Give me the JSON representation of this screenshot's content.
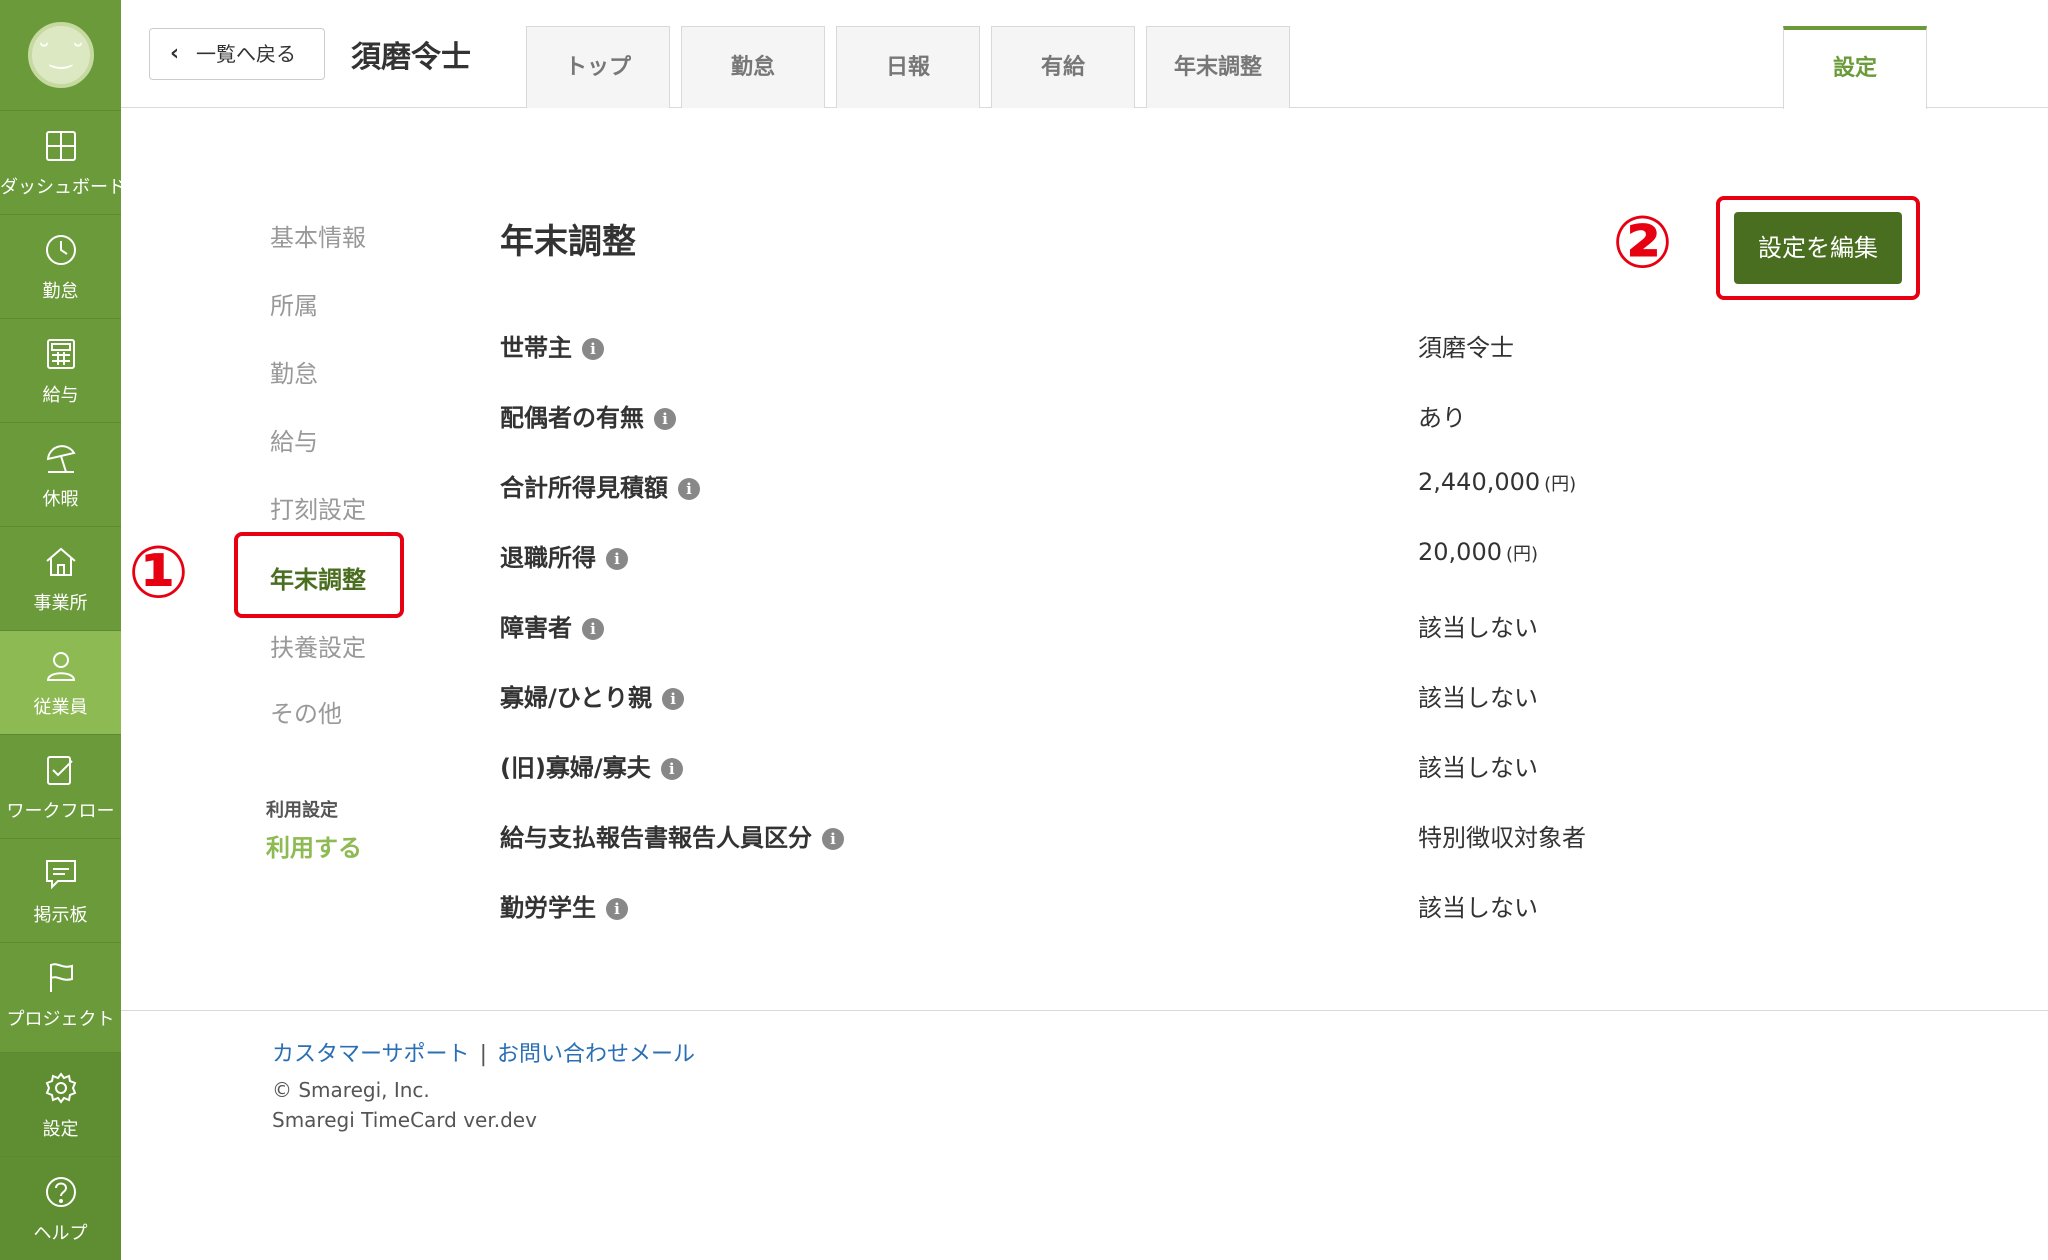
{
  "sidebar": {
    "items": [
      {
        "label": "ダッシュボード",
        "icon": "grid-icon"
      },
      {
        "label": "勤怠",
        "icon": "clock-icon"
      },
      {
        "label": "給与",
        "icon": "calculator-icon"
      },
      {
        "label": "休暇",
        "icon": "beach-umbrella-icon"
      },
      {
        "label": "事業所",
        "icon": "house-icon"
      },
      {
        "label": "従業員",
        "icon": "person-icon"
      },
      {
        "label": "ワークフロー",
        "icon": "checklist-icon"
      },
      {
        "label": "掲示板",
        "icon": "chat-bubble-icon"
      },
      {
        "label": "プロジェクト",
        "icon": "flag-icon"
      },
      {
        "label": "設定",
        "icon": "gear-icon"
      },
      {
        "label": "ヘルプ",
        "icon": "help-icon"
      }
    ],
    "active_index": 5
  },
  "header": {
    "back_label": "一覧へ戻る",
    "employee_name": "須磨令士",
    "tabs": [
      "トップ",
      "勤怠",
      "日報",
      "有給",
      "年末調整",
      "設定"
    ],
    "active_tab": "設定"
  },
  "subnav": {
    "items": [
      "基本情報",
      "所属",
      "勤怠",
      "給与",
      "打刻設定",
      "年末調整",
      "扶養設定",
      "その他"
    ],
    "active": "年末調整",
    "use_setting_label": "利用設定",
    "use_setting_value": "利用する"
  },
  "annotations": {
    "one": "①",
    "two": "②"
  },
  "main": {
    "title": "年末調整",
    "edit_button": "設定を編集",
    "rows": [
      {
        "label": "世帯主",
        "value": "須磨令士",
        "unit": ""
      },
      {
        "label": "配偶者の有無",
        "value": "あり",
        "unit": ""
      },
      {
        "label": "合計所得見積額",
        "value": "2,440,000",
        "unit": "(円)"
      },
      {
        "label": "退職所得",
        "value": "20,000",
        "unit": "(円)"
      },
      {
        "label": "障害者",
        "value": "該当しない",
        "unit": ""
      },
      {
        "label": "寡婦/ひとり親",
        "value": "該当しない",
        "unit": ""
      },
      {
        "label": "(旧)寡婦/寡夫",
        "value": "該当しない",
        "unit": ""
      },
      {
        "label": "給与支払報告書報告人員区分",
        "value": "特別徴収対象者",
        "unit": ""
      },
      {
        "label": "勤労学生",
        "value": "該当しない",
        "unit": ""
      }
    ]
  },
  "footer": {
    "support_link": "カスタマーサポート",
    "separator": "|",
    "contact_link": "お問い合わせメール",
    "copyright": "© Smaregi, Inc.",
    "version": "Smaregi TimeCard ver.dev"
  },
  "colors": {
    "brand_green": "#6a9a3a",
    "dark_green": "#4a6e1f",
    "annotation_red": "#e60012",
    "link_blue": "#2a6fb5"
  }
}
